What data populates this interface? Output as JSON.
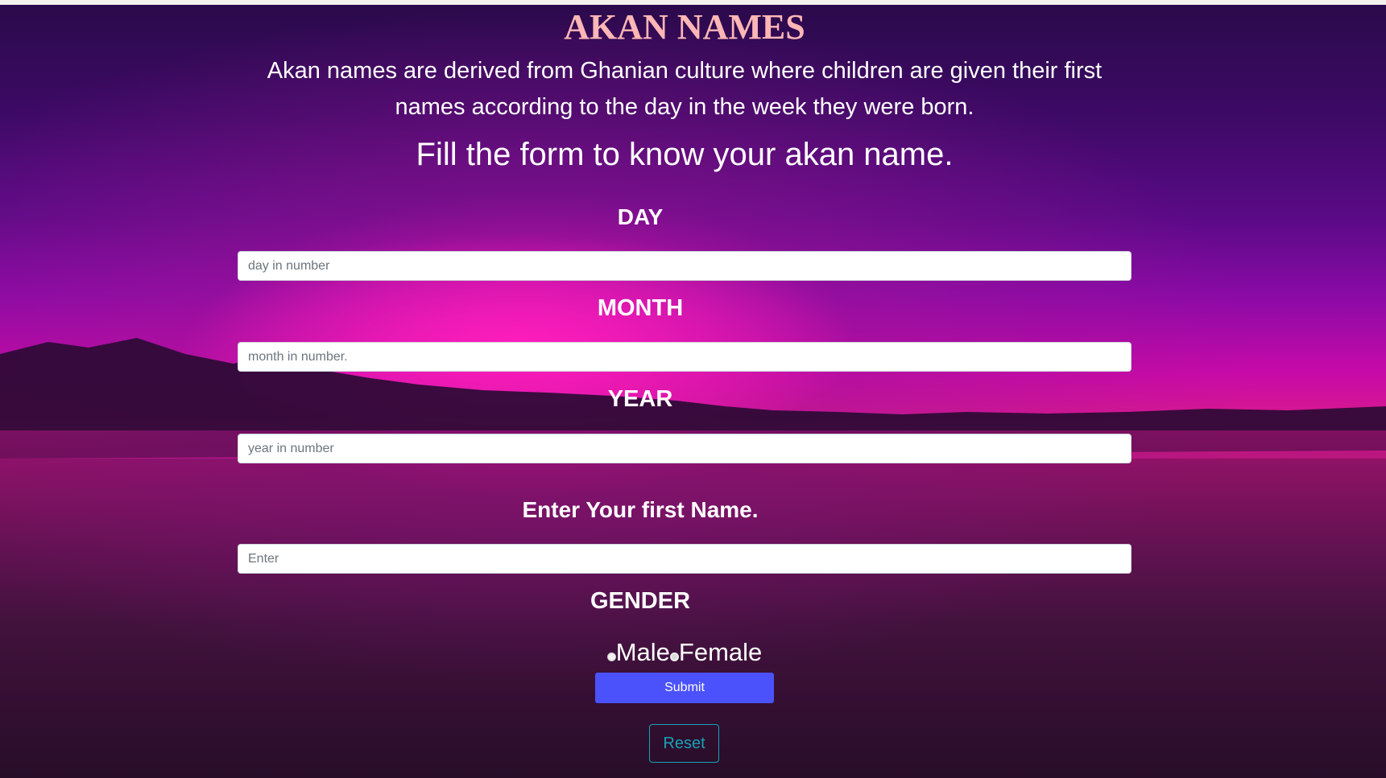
{
  "page": {
    "title": "AKAN NAMES",
    "intro": "Akan names are derived from Ghanian culture where children are given their first names according to the day in the week they were born.",
    "cta": "Fill the form to know your akan name."
  },
  "form": {
    "day": {
      "label": "DAY",
      "placeholder": "day in number",
      "value": ""
    },
    "month": {
      "label": "MONTH",
      "placeholder": "month in number.",
      "value": ""
    },
    "year": {
      "label": "YEAR",
      "placeholder": "year in number",
      "value": ""
    },
    "first_name": {
      "label": "Enter Your first Name.",
      "placeholder": "Enter",
      "value": ""
    },
    "gender": {
      "label": "GENDER",
      "options": [
        {
          "label": "Male",
          "selected": false
        },
        {
          "label": "Female",
          "selected": false
        }
      ]
    },
    "submit_label": "Submit",
    "reset_label": "Reset"
  },
  "colors": {
    "title": "#ffb6b6",
    "submit_bg": "#4b52fc",
    "reset_border": "#17a2b8"
  }
}
